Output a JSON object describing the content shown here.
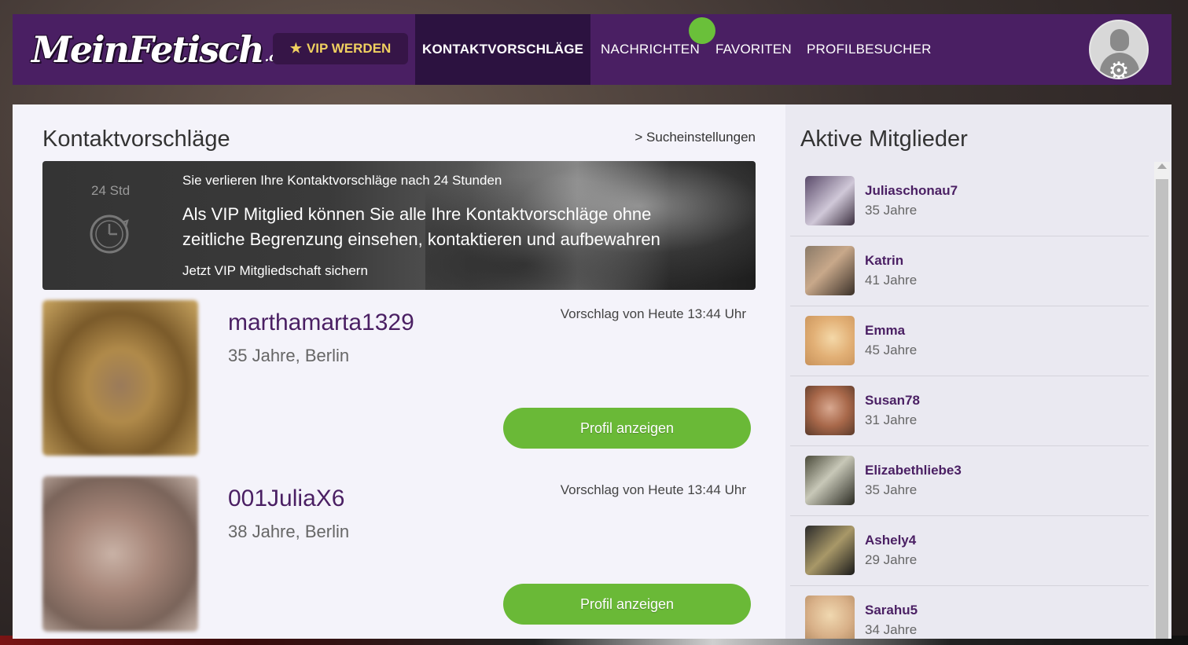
{
  "header": {
    "logo_text": "MeinFetisch",
    "logo_suffix": ".com",
    "vip_label": "VIP WERDEN",
    "vip_icon": "star-icon",
    "nav": [
      {
        "label": "KONTAKTVORSCHLÄGE",
        "active": true
      },
      {
        "label": "NACHRICHTEN",
        "active": false
      },
      {
        "label": "FAVORITEN",
        "active": false
      },
      {
        "label": "PROFILBESUCHER",
        "active": false
      }
    ],
    "settings_icon": "gear-icon"
  },
  "main": {
    "title": "Kontaktvorschläge",
    "search_link": "> Sucheinstellungen",
    "banner": {
      "timer_label": "24 Std",
      "small_text": "Sie verlieren Ihre Kontaktvorschläge nach 24 Stunden",
      "big_text": "Als VIP Mitglied können Sie alle Ihre Kontaktvorschläge ohne zeitliche Begrenzung einsehen, kontaktieren und aufbewahren",
      "cta": "Jetzt VIP Mitgliedschaft sichern"
    },
    "cards": [
      {
        "name": "marthamarta1329",
        "info": "35 Jahre, Berlin",
        "time": "Vorschlag von Heute 13:44 Uhr",
        "button": "Profil anzeigen"
      },
      {
        "name": "001JuliaX6",
        "info": "38 Jahre, Berlin",
        "time": "Vorschlag von Heute 13:44 Uhr",
        "button": "Profil anzeigen"
      }
    ]
  },
  "sidebar": {
    "title": "Aktive Mitglieder",
    "members": [
      {
        "name": "Juliaschonau7",
        "age": "35 Jahre"
      },
      {
        "name": "Katrin",
        "age": "41 Jahre"
      },
      {
        "name": "Emma",
        "age": "45 Jahre"
      },
      {
        "name": "Susan78",
        "age": "31 Jahre"
      },
      {
        "name": "Elizabethliebe3",
        "age": "35 Jahre"
      },
      {
        "name": "Ashely4",
        "age": "29 Jahre"
      },
      {
        "name": "Sarahu5",
        "age": "34 Jahre"
      }
    ]
  },
  "colors": {
    "brand_purple": "#4a1f63",
    "nav_active": "#2c1240",
    "button_green": "#6ab937",
    "notification": "#6ac03a",
    "vip_gold": "#f0d060"
  }
}
